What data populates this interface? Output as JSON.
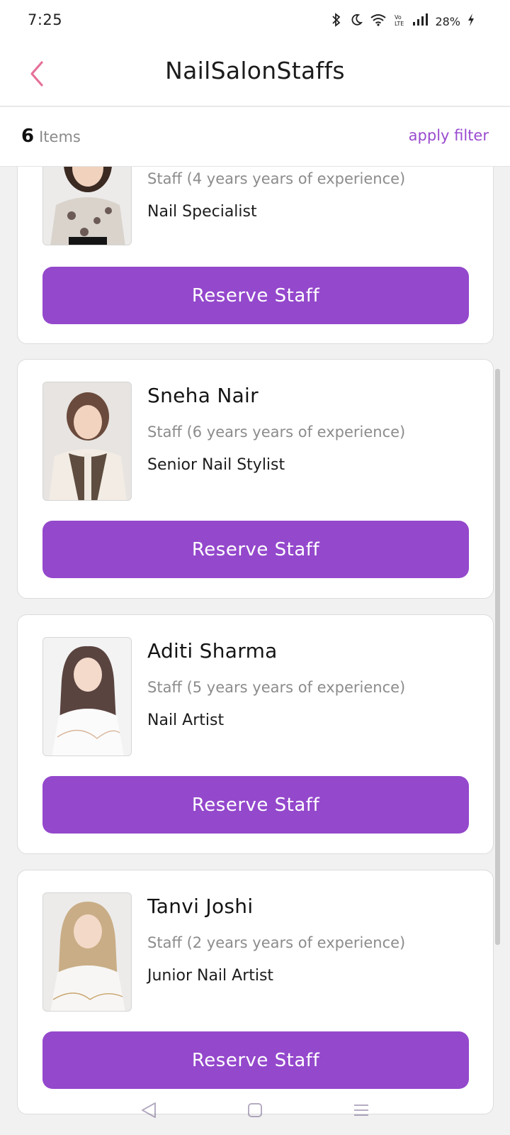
{
  "status_bar": {
    "time": "7:25",
    "battery": "28%",
    "icons": [
      "bluetooth-icon",
      "moon-icon",
      "wifi-icon",
      "volte-icon",
      "signal-icon",
      "charging-icon"
    ]
  },
  "header": {
    "title": "NailSalonStaffs",
    "back_icon": "chevron-left-icon",
    "accent_color": "#e6709a"
  },
  "filter_bar": {
    "count": "6",
    "count_label": "Items",
    "filter_label": "apply filter",
    "filter_color": "#9a4bcf"
  },
  "staff_list": [
    {
      "name": "",
      "experience": "Staff (4 years years of experience)",
      "role": "Nail Specialist",
      "button_label": "Reserve Staff"
    },
    {
      "name": "Sneha Nair",
      "experience": "Staff (6 years years of experience)",
      "role": "Senior Nail Stylist",
      "button_label": "Reserve Staff"
    },
    {
      "name": "Aditi Sharma",
      "experience": "Staff (5 years years of experience)",
      "role": "Nail Artist",
      "button_label": "Reserve Staff"
    },
    {
      "name": "Tanvi Joshi",
      "experience": "Staff (2 years years of experience)",
      "role": "Junior Nail Artist",
      "button_label": "Reserve Staff"
    }
  ],
  "theme": {
    "button_color": "#9448cc",
    "background": "#f1f1f1"
  }
}
